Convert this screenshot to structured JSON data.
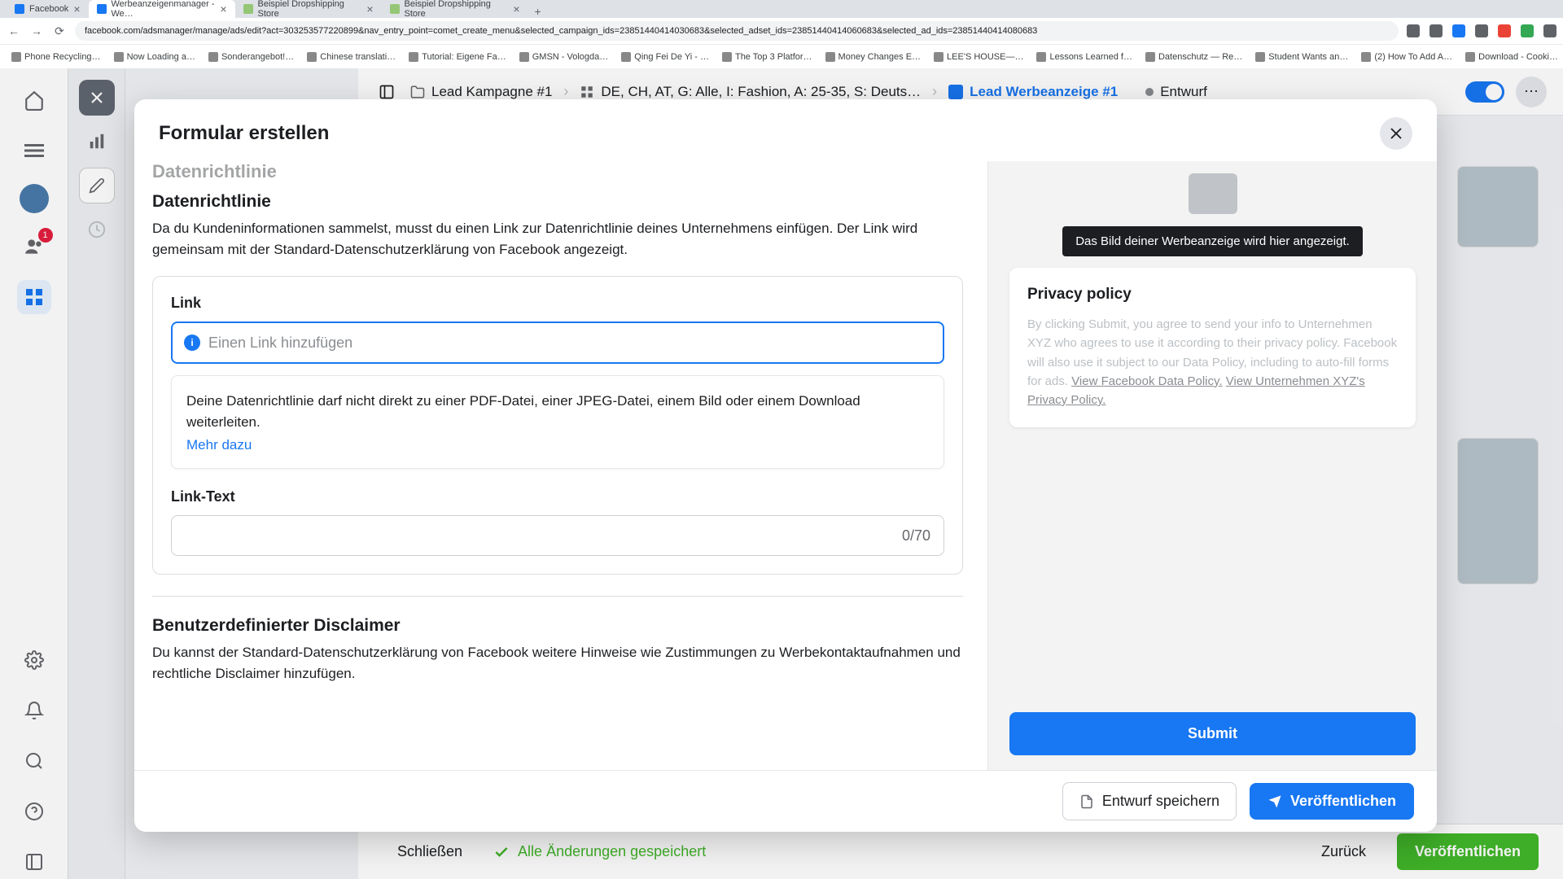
{
  "browser": {
    "tabs": [
      {
        "label": "Facebook"
      },
      {
        "label": "Werbeanzeigenmanager - We…"
      },
      {
        "label": "Beispiel Dropshipping Store"
      },
      {
        "label": "Beispiel Dropshipping Store"
      }
    ],
    "url": "facebook.com/adsmanager/manage/ads/edit?act=303253577220899&nav_entry_point=comet_create_menu&selected_campaign_ids=23851440414030683&selected_adset_ids=23851440414060683&selected_ad_ids=23851440414080683",
    "bookmarks": [
      "Phone Recycling…",
      "Now Loading a…",
      "Sonderangebot!…",
      "Chinese translati…",
      "Tutorial: Eigene Fa…",
      "GMSN - Vologda…",
      "Qing Fei De Yi - …",
      "The Top 3 Platfor…",
      "Money Changes E…",
      "LEE'S HOUSE—…",
      "Lessons Learned f…",
      "Datenschutz — Re…",
      "Student Wants an…",
      "(2) How To Add A…",
      "Download - Cooki…"
    ]
  },
  "rail": {
    "badge": "1"
  },
  "crumbs": {
    "campaign": "Lead Kampagne #1",
    "adset": "DE, CH, AT, G: Alle, I: Fashion, A: 25-35, S: Deuts…",
    "ad": "Lead Werbeanzeige #1",
    "status": "Entwurf"
  },
  "modal": {
    "title": "Formular erstellen",
    "scrolled_heading": "Datenrichtlinie",
    "section1": {
      "heading": "Datenrichtlinie",
      "help": "Da du Kundeninformationen sammelst, musst du einen Link zur Datenrichtlinie deines Unternehmens einfügen. Der Link wird gemeinsam mit der Standard-Datenschutzerklärung von Facebook angezeigt.",
      "link_label": "Link",
      "link_placeholder": "Einen Link hinzufügen",
      "note": "Deine Datenrichtlinie darf nicht direkt zu einer PDF-Datei, einer JPEG-Datei, einem Bild oder einem Download weiterleiten.",
      "more": "Mehr dazu",
      "linktext_label": "Link-Text",
      "linktext_counter": "0/70"
    },
    "section2": {
      "heading": "Benutzerdefinierter Disclaimer",
      "help": "Du kannst der Standard-Datenschutzerklärung von Facebook weitere Hinweise wie Zustimmungen zu Werbekontaktaufnahmen und rechtliche Disclaimer hinzufügen."
    },
    "preview": {
      "tooltip": "Das Bild deiner Werbeanzeige wird hier angezeigt.",
      "card_title": "Privacy policy",
      "para": "By clicking Submit, you agree to send your info to Unternehmen XYZ who agrees to use it according to their privacy policy. Facebook will also use it subject to our Data Policy, including to auto-fill forms for ads. ",
      "link1": "View Facebook Data Policy.",
      "link2": "View Unternehmen XYZ's Privacy Policy.",
      "submit": "Submit"
    },
    "footer": {
      "save_draft": "Entwurf speichern",
      "publish": "Veröffentlichen"
    }
  },
  "bottom": {
    "close": "Schließen",
    "saved": "Alle Änderungen gespeichert",
    "back": "Zurück",
    "publish": "Veröffentlichen"
  }
}
